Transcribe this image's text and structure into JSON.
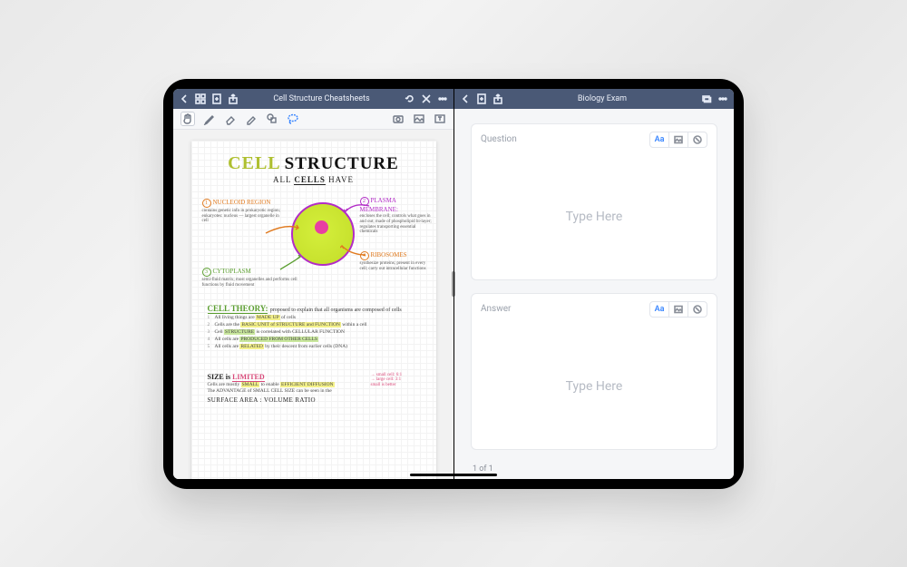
{
  "left": {
    "title": "Cell Structure Cheatsheets",
    "note": {
      "title_word1": "CELL",
      "title_word2": "STRUCTURE",
      "subtitle_pre": "ALL ",
      "subtitle_em": "CELLS",
      "subtitle_post": " HAVE",
      "labels": {
        "nucleoid": {
          "n": "1",
          "name": "NUCLEOID REGION",
          "body": "contains genetic info in prokaryotic region; eukaryotes: nucleus — largest organelle in cell"
        },
        "plasma": {
          "n": "2",
          "name": "PLASMA MEMBRANE:",
          "body": "encloses the cell; controls what goes in and out; made of phospholipid bi-layer; regulates transporting essential chemicals"
        },
        "cytoplasm": {
          "n": "3",
          "name": "CYTOPLASM",
          "body": "semi-fluid matrix; most organelles and performs cell functions by fluid movement"
        },
        "ribosomes": {
          "n": "4",
          "name": "RIBOSOMES",
          "body": "synthesize proteins; present in every cell; carry out intracellular functions"
        }
      },
      "theory": {
        "heading_main": "CELL THEORY:",
        "heading_rest": "proposed to explain that all organisms are composed of cells",
        "lines": [
          {
            "n": "1",
            "pre": "All living things are ",
            "mark": "MADE UP",
            "post": " of cells",
            "cls": "mark-y"
          },
          {
            "n": "2",
            "pre": "Cells are the ",
            "mark": "BASIC UNIT of STRUCTURE and FUNCTION",
            "post": " within a cell",
            "cls": "mark-y"
          },
          {
            "n": "3",
            "pre": "Cell ",
            "mark": "STRUCTURE",
            "post": " is correlated with CELLULAR FUNCTION",
            "cls": "mark-g"
          },
          {
            "n": "4",
            "pre": "All cells are ",
            "mark": "PRODUCED FROM OTHER CELLS",
            "post": "",
            "cls": "mark-g"
          },
          {
            "n": "5",
            "pre": "All cells are ",
            "mark": "RELATED",
            "post": " by their descent from earlier cells   (DNA)",
            "cls": "mark-y"
          }
        ]
      },
      "size": {
        "heading_pre": "SIZE is ",
        "heading_u": "LIMITED",
        "l1_pre": "Cells are mostly ",
        "l1_m1": "SMALL",
        "l1_mid": " to enable ",
        "l1_m2": "EFFICIENT DIFFUSION",
        "l2": "The ADVANTAGE of SMALL CELL SIZE can be seen in the",
        "ratio": "SURFACE AREA : VOLUME RATIO",
        "side1": "→ small cell: 6:1",
        "side2": "→ large cell: 3:1",
        "side3": "small is better"
      }
    }
  },
  "right": {
    "title": "Biology Exam",
    "question_label": "Question",
    "answer_label": "Answer",
    "placeholder": "Type Here",
    "text_tool": "Aa",
    "pager": "1 of 1"
  }
}
